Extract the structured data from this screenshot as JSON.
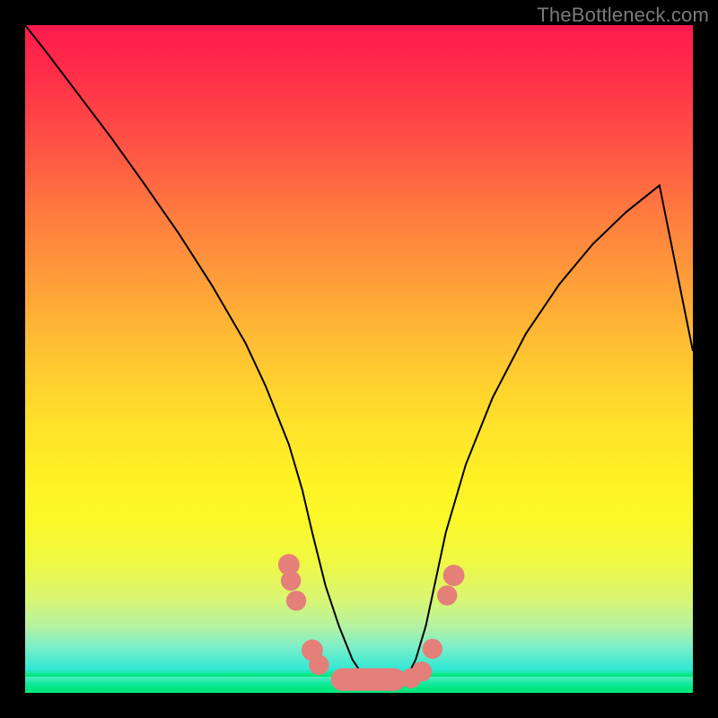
{
  "watermark": "TheBottleneck.com",
  "colors": {
    "frame": "#000000",
    "gradient_top": "#ff1a4d",
    "gradient_bottom": "#00e676",
    "curve": "#000000",
    "markers": "#e47f7a"
  },
  "chart_data": {
    "type": "line",
    "title": "",
    "xlabel": "",
    "ylabel": "",
    "xlim": [
      0,
      100
    ],
    "ylim": [
      0,
      100
    ],
    "grid": false,
    "legend": false,
    "note": "Axis values are percentages of the plot area; the curve is a V-shaped profile with a flat trough.",
    "series": [
      {
        "name": "curve",
        "x": [
          0,
          3,
          8,
          13,
          18,
          23,
          28,
          33,
          36,
          39.5,
          41.5,
          43,
          45,
          47,
          49,
          51,
          53,
          55,
          57,
          58.5,
          60,
          61.5,
          63,
          66,
          70,
          75,
          80,
          85,
          90,
          95,
          100
        ],
        "y": [
          100,
          96.2,
          89.6,
          83,
          76,
          68.8,
          61,
          52.4,
          46,
          37.2,
          30.4,
          24,
          16,
          10,
          5,
          2,
          1,
          1,
          2,
          5,
          10,
          17,
          24,
          34.2,
          44.2,
          53.8,
          61.2,
          67.2,
          72,
          76,
          51.2
        ]
      }
    ],
    "markers": [
      {
        "shape": "dot",
        "x": 39.5,
        "y": 19.2,
        "r": 1.6
      },
      {
        "shape": "dot",
        "x": 39.8,
        "y": 16.8,
        "r": 1.5
      },
      {
        "shape": "dot",
        "x": 40.6,
        "y": 13.8,
        "r": 1.5
      },
      {
        "shape": "dot",
        "x": 43.0,
        "y": 6.4,
        "r": 1.6
      },
      {
        "shape": "dot",
        "x": 44.0,
        "y": 4.2,
        "r": 1.5
      },
      {
        "shape": "dot",
        "x": 63.2,
        "y": 14.6,
        "r": 1.5
      },
      {
        "shape": "dot",
        "x": 64.2,
        "y": 17.6,
        "r": 1.6
      },
      {
        "shape": "pill",
        "x1": 45.8,
        "y1": 2.0,
        "x2": 57.0,
        "y2": 2.0,
        "r": 1.7
      },
      {
        "shape": "dot",
        "x": 57.8,
        "y": 2.2,
        "r": 1.5
      },
      {
        "shape": "dot",
        "x": 59.4,
        "y": 3.2,
        "r": 1.5
      },
      {
        "shape": "dot",
        "x": 61.0,
        "y": 6.6,
        "r": 1.5
      }
    ]
  }
}
